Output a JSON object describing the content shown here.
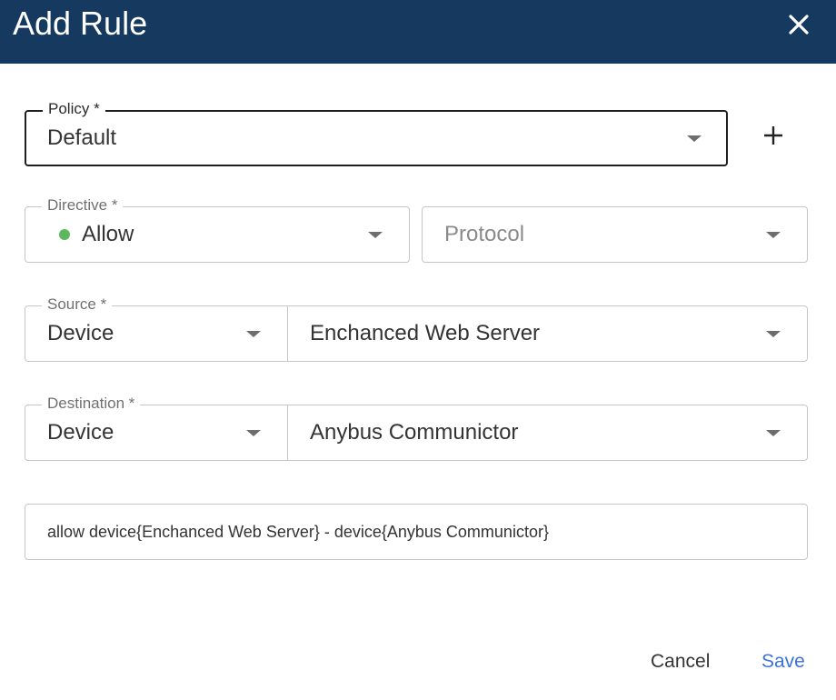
{
  "dialog": {
    "title": "Add Rule"
  },
  "policy": {
    "label": "Policy *",
    "value": "Default"
  },
  "directive": {
    "label": "Directive *",
    "value": "Allow",
    "status_color": "#5cb85c"
  },
  "protocol": {
    "placeholder": "Protocol"
  },
  "source": {
    "label": "Source *",
    "type_value": "Device",
    "target_value": "Enchanced Web Server"
  },
  "destination": {
    "label": "Destination *",
    "type_value": "Device",
    "target_value": "Anybus Communictor"
  },
  "rule_summary": {
    "value": "allow device{Enchanced Web Server} - device{Anybus Communictor}"
  },
  "footer": {
    "cancel_label": "Cancel",
    "save_label": "Save"
  },
  "colors": {
    "header_bg": "#163a5f",
    "accent": "#3b73d9"
  },
  "icons": {
    "close": "close-icon",
    "add": "plus-icon",
    "dropdown": "chevron-down-icon"
  }
}
